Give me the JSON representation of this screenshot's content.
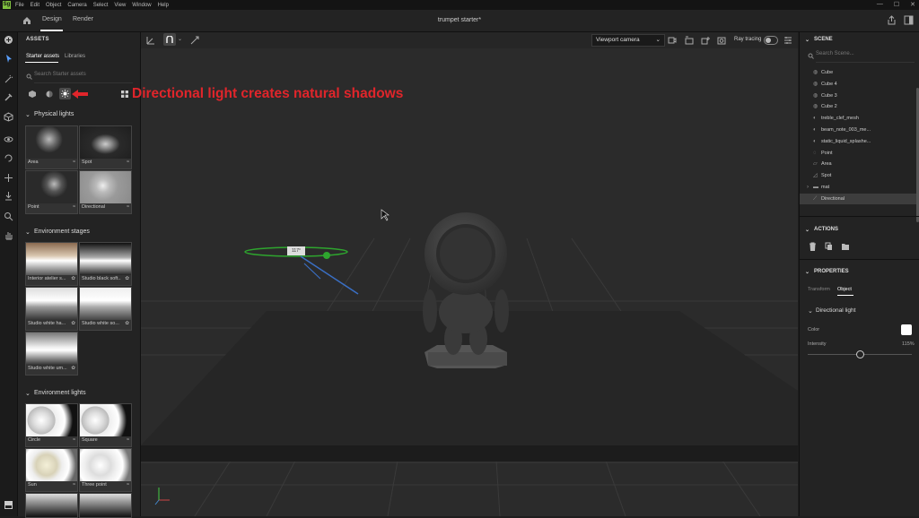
{
  "menubar": {
    "logo": "Sg",
    "items": [
      "File",
      "Edit",
      "Object",
      "Camera",
      "Select",
      "View",
      "Window",
      "Help"
    ],
    "window_controls": [
      "—",
      "☐",
      "✕"
    ]
  },
  "topbar": {
    "tabs": [
      "Design",
      "Render"
    ],
    "document_title": "trumpet starter*"
  },
  "assets": {
    "title": "ASSETS",
    "tabs": [
      "Starter assets",
      "Libraries"
    ],
    "search_placeholder": "Search Starter assets",
    "sections": {
      "physical_lights": {
        "title": "Physical lights",
        "items": [
          "Area",
          "Spot",
          "Point",
          "Directional"
        ]
      },
      "environment_stages": {
        "title": "Environment stages",
        "items": [
          "Interior atelier s...",
          "Studio black soft...",
          "Studio white ha...",
          "Studio white so...",
          "Studio white um..."
        ]
      },
      "environment_lights": {
        "title": "Environment lights",
        "items": [
          "Circle",
          "Square",
          "Sun",
          "Three point"
        ]
      }
    }
  },
  "annotation": "Directional light creates natural shadows",
  "viewport": {
    "camera": "Viewport camera",
    "ray_tracing_label": "Ray tracing",
    "light_gizmo_value": "117°"
  },
  "scene": {
    "title": "SCENE",
    "search_placeholder": "Search Scene...",
    "items": [
      {
        "label": "Cube",
        "icon": "shape-icon"
      },
      {
        "label": "Cube 4",
        "icon": "shape-icon"
      },
      {
        "label": "Cube 3",
        "icon": "shape-icon"
      },
      {
        "label": "Cube 2",
        "icon": "shape-icon"
      },
      {
        "label": "treble_clef_mesh",
        "icon": "mesh-icon"
      },
      {
        "label": "beam_note_003_me...",
        "icon": "mesh-icon"
      },
      {
        "label": "static_liquid_splashe...",
        "icon": "mesh-icon"
      },
      {
        "label": "Point",
        "icon": "point-light-icon"
      },
      {
        "label": "Area",
        "icon": "area-light-icon"
      },
      {
        "label": "Spot",
        "icon": "spot-light-icon"
      },
      {
        "label": "mat",
        "icon": "folder-icon"
      },
      {
        "label": "Directional",
        "icon": "directional-light-icon"
      }
    ],
    "selected": "Directional"
  },
  "actions": {
    "title": "ACTIONS"
  },
  "properties": {
    "title": "PROPERTIES",
    "tabs": [
      "Transform",
      "Object"
    ],
    "active_tab": "Object",
    "section": "Directional light",
    "color_label": "Color",
    "color_value": "#ffffff",
    "intensity_label": "Intensity",
    "intensity_value": "115%",
    "intensity_fraction": 0.5
  }
}
